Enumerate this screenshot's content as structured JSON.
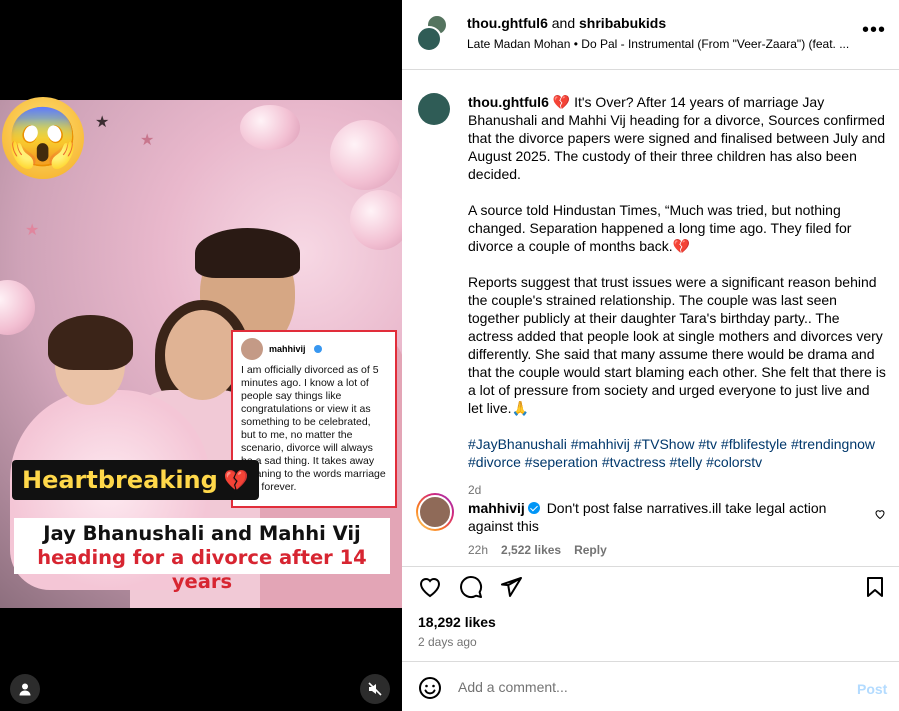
{
  "media": {
    "headline_line1": "Jay Bhanushali and Mahhi Vij",
    "headline_line2": "heading for a divorce after 14 years",
    "tag_label": "Heartbreaking",
    "tag_emoji": "💔",
    "face_emoji": "😱",
    "quote_card": {
      "username": "mahhivij",
      "text": "I am officially divorced as of 5 minutes ago. I know a lot of people say things like congratulations or view it as something to be celebrated, but to me, no matter the scenario, divorce will always be a sad thing. It takes away meaning to the words marriage and forever."
    }
  },
  "header": {
    "user1": "thou.ghtful6",
    "joiner": "and",
    "user2": "shribabukids",
    "audio": "Late Madan Mohan • Do Pal - Instrumental (From \"Veer-Zaara\") (feat. ..."
  },
  "caption": {
    "username": "thou.ghtful6",
    "para1": "💔 It's Over? After 14 years of marriage Jay Bhanushali and Mahhi Vij heading for a divorce, Sources confirmed that the divorce papers were signed and finalised between July and August 2025. The custody of their three children has also been decided.",
    "para2": "A source told Hindustan Times, “Much was tried, but nothing changed. Separation happened a long time ago. They filed for divorce a couple of months back.💔",
    "para3": "Reports suggest that trust issues were a significant reason behind the couple's strained relationship. The couple was last seen together publicly at their daughter Tara's birthday party.. The actress added that people look at single mothers and divorces very differently. She said that many assume there would be drama and that the couple would start blaming each other. She felt that there is a lot of pressure from society and urged everyone to just live and let live.🙏",
    "hashtags": "#JayBhanushali #mahhivij #TVShow #tv #fblifestyle #trendingnow #divorce #seperation #tvactress #telly #colorstv",
    "time": "2d"
  },
  "comment": {
    "username": "mahhivij",
    "text": "Don't post false narratives.ill take legal action against this",
    "time": "22h",
    "likes": "2,522 likes",
    "reply": "Reply"
  },
  "actions": {
    "likes": "18,292 likes",
    "date": "2 days ago"
  },
  "add_comment": {
    "placeholder": "Add a comment...",
    "post_label": "Post"
  }
}
